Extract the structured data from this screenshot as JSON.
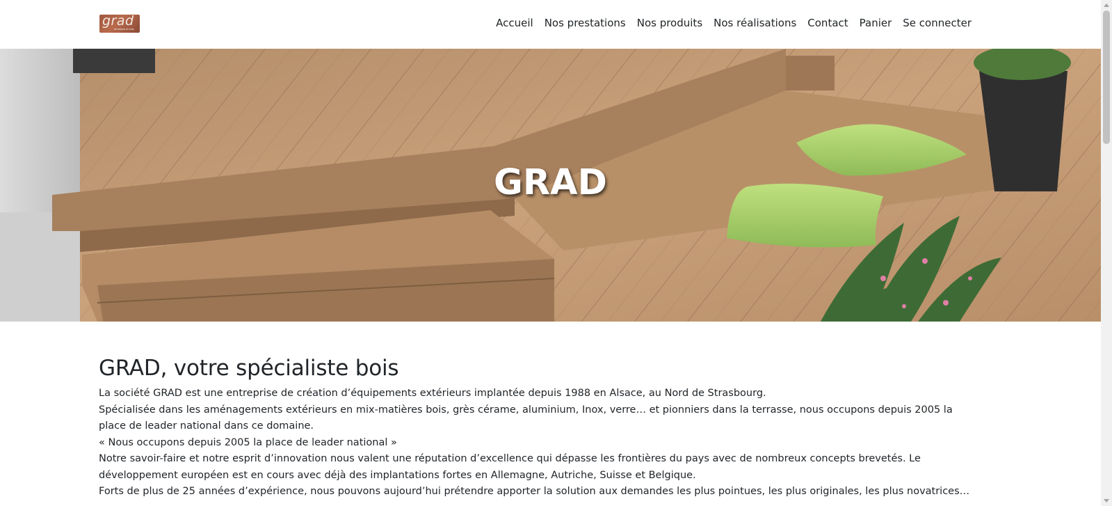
{
  "header": {
    "logo_text": "grad",
    "logo_subtext": "terrasses & bois",
    "nav": [
      {
        "label": "Accueil"
      },
      {
        "label": "Nos prestations"
      },
      {
        "label": "Nos produits"
      },
      {
        "label": "Nos réalisations"
      },
      {
        "label": "Contact"
      },
      {
        "label": "Panier"
      },
      {
        "label": "Se connecter"
      }
    ]
  },
  "hero": {
    "title": "GRAD"
  },
  "main": {
    "heading": "GRAD, votre spécialiste bois",
    "paragraphs": [
      "La société GRAD est une entreprise de création d’équipements extérieurs implantée depuis 1988 en Alsace, au Nord de Strasbourg.",
      "Spécialisée dans les aménagements extérieurs en mix-matières bois, grès cérame, aluminium, Inox, verre… et pionniers dans la terrasse, nous occupons depuis 2005 la place de leader national dans ce domaine.",
      "« Nous occupons depuis 2005 la place de leader national »",
      "Notre savoir-faire et notre esprit d’innovation nous valent une réputation d’excellence qui dépasse les frontières du pays avec de nombreux concepts brevetés. Le développement européen est en cours avec déjà des implantations fortes en Allemagne, Autriche, Suisse et Belgique.",
      "Forts de plus de 25 années d’expérience, nous pouvons aujourd’hui prétendre apporter la solution aux demandes les plus pointues, les plus originales, les plus novatrices…"
    ]
  },
  "colors": {
    "wood_light": "#c39a72",
    "wood_dark": "#8c6545",
    "cushion": "#a9cf6f",
    "text": "#212529"
  }
}
